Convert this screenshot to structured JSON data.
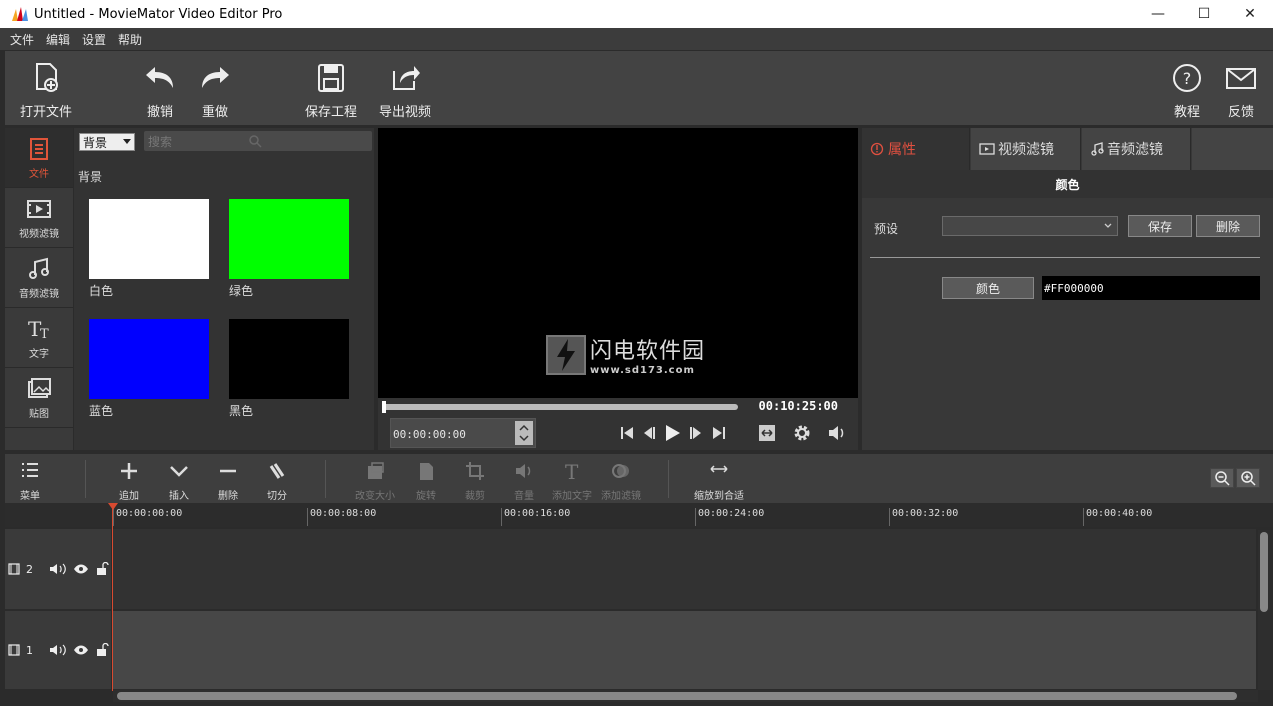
{
  "window": {
    "title": "Untitled - MovieMator Video Editor Pro",
    "minimize": "—",
    "maximize": "☐",
    "close": "✕"
  },
  "menu": [
    "文件",
    "编辑",
    "设置",
    "帮助"
  ],
  "toolbar": {
    "open": "打开文件",
    "undo": "撤销",
    "redo": "重做",
    "save_project": "保存工程",
    "export": "导出视频",
    "tutorial": "教程",
    "feedback": "反馈"
  },
  "left_tabs": [
    {
      "label": "文件",
      "icon": "file-icon",
      "active": true
    },
    {
      "label": "视频滤镜",
      "icon": "video-filter-icon"
    },
    {
      "label": "音频滤镜",
      "icon": "audio-filter-icon"
    },
    {
      "label": "文字",
      "icon": "text-icon"
    },
    {
      "label": "贴图",
      "icon": "sticker-icon"
    }
  ],
  "library": {
    "category": "背景",
    "search_placeholder": "搜索",
    "section": "背景",
    "items": [
      {
        "label": "白色",
        "color": "#FFFFFF"
      },
      {
        "label": "绿色",
        "color": "#00FF00"
      },
      {
        "label": "蓝色",
        "color": "#0000FF"
      },
      {
        "label": "黑色",
        "color": "#000000"
      }
    ]
  },
  "watermark": {
    "name": "闪电软件园",
    "url": "www.sd173.com"
  },
  "player": {
    "duration": "00:10:25:00",
    "timecode": "00:00:00:00",
    "progress": 0
  },
  "properties": {
    "tabs": [
      "属性",
      "视频滤镜",
      "音频滤镜"
    ],
    "heading": "颜色",
    "preset_label": "预设",
    "preset_value": "",
    "save": "保存",
    "delete": "删除",
    "color_button": "颜色",
    "color_value": "#FF000000"
  },
  "timeline_toolbar": {
    "menu": "菜单",
    "append": "追加",
    "insert": "插入",
    "remove": "删除",
    "split": "切分",
    "resize": "改变大小",
    "rotate": "旋转",
    "crop": "裁剪",
    "volume": "音量",
    "add_text": "添加文字",
    "add_filter": "添加滤镜",
    "fit": "缩放到合适"
  },
  "ruler": [
    "00:00:00:00",
    "00:00:08:00",
    "00:00:16:00",
    "00:00:24:00",
    "00:00:32:00",
    "00:00:40:00"
  ],
  "tracks": [
    {
      "name": "2",
      "icon": "film-icon"
    },
    {
      "name": "1",
      "icon": "film-icon"
    }
  ],
  "colors": {
    "accent": "#E05040",
    "panel": "#383838",
    "toolbar": "#434343"
  }
}
